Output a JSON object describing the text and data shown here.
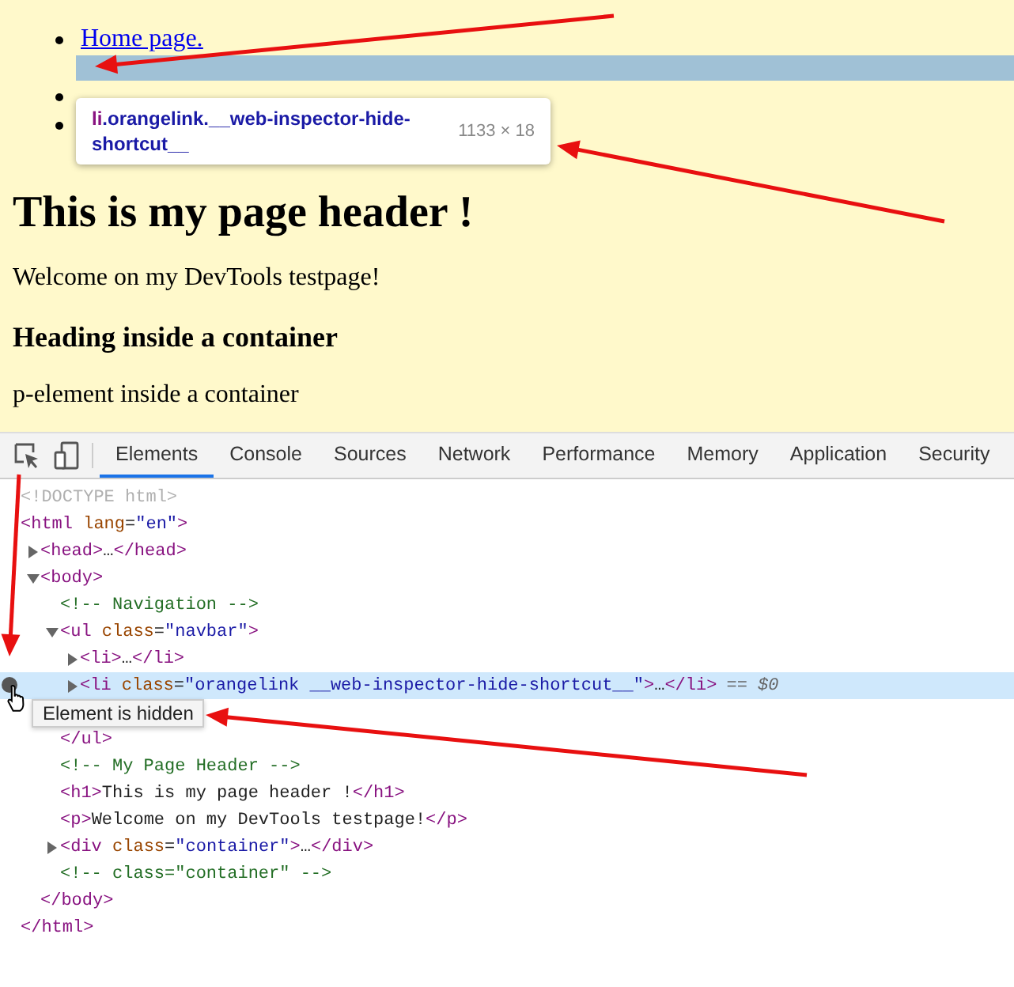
{
  "page": {
    "nav_items": [
      {
        "kind": "link",
        "label": "Home page."
      },
      {
        "kind": "highlight"
      },
      {
        "kind": "covered"
      },
      {
        "kind": "covered"
      }
    ],
    "inspect_tooltip": {
      "tag": "li",
      "classes": ".orangelink.__web-inspector-hide-shortcut__",
      "size": "1133 × 18"
    },
    "header": "This is my page header !",
    "welcome": "Welcome on my DevTools testpage!",
    "container_heading": "Heading inside a container",
    "container_text": "p-element inside a container"
  },
  "devtools": {
    "tabs": [
      {
        "label": "Elements",
        "selected": true
      },
      {
        "label": "Console",
        "selected": false
      },
      {
        "label": "Sources",
        "selected": false
      },
      {
        "label": "Network",
        "selected": false
      },
      {
        "label": "Performance",
        "selected": false
      },
      {
        "label": "Memory",
        "selected": false
      },
      {
        "label": "Application",
        "selected": false
      },
      {
        "label": "Security",
        "selected": false
      }
    ],
    "dom_tree": [
      {
        "tokens": [
          {
            "kind": "doctype",
            "t": "<!DOCTYPE html>"
          }
        ],
        "selected": false
      },
      {
        "tokens": [
          {
            "kind": "tag",
            "t": "<html "
          },
          {
            "kind": "attr",
            "t": "lang"
          },
          {
            "kind": "text",
            "t": "="
          },
          {
            "kind": "value",
            "t": "\"en\""
          },
          {
            "kind": "tag",
            "t": ">"
          }
        ],
        "selected": false,
        "close": [
          {
            "kind": "tag",
            "t": "</html>"
          }
        ],
        "children": [
          {
            "tokens": [
              {
                "kind": "tag",
                "t": "<head>"
              },
              {
                "kind": "text",
                "t": "…"
              },
              {
                "kind": "tag",
                "t": "</head>"
              }
            ],
            "expanded": false,
            "selected": false
          },
          {
            "tokens": [
              {
                "kind": "tag",
                "t": "<body>"
              }
            ],
            "expanded": true,
            "selected": false,
            "close": [
              {
                "kind": "tag",
                "t": "</body>"
              }
            ],
            "children": [
              {
                "tokens": [
                  {
                    "kind": "comment",
                    "t": "<!-- Navigation -->"
                  }
                ],
                "selected": false
              },
              {
                "tokens": [
                  {
                    "kind": "tag",
                    "t": "<ul "
                  },
                  {
                    "kind": "attr",
                    "t": "class"
                  },
                  {
                    "kind": "text",
                    "t": "="
                  },
                  {
                    "kind": "value",
                    "t": "\"navbar\""
                  },
                  {
                    "kind": "tag",
                    "t": ">"
                  }
                ],
                "expanded": true,
                "selected": false,
                "close": [
                  {
                    "kind": "tag",
                    "t": "</ul>"
                  }
                ],
                "children": [
                  {
                    "tokens": [
                      {
                        "kind": "tag",
                        "t": "<li>"
                      },
                      {
                        "kind": "text",
                        "t": "…"
                      },
                      {
                        "kind": "tag",
                        "t": "</li>"
                      }
                    ],
                    "expanded": false,
                    "selected": false,
                    "hidden": false
                  },
                  {
                    "tokens": [
                      {
                        "kind": "tag",
                        "t": "<li "
                      },
                      {
                        "kind": "attr",
                        "t": "class"
                      },
                      {
                        "kind": "text",
                        "t": "="
                      },
                      {
                        "kind": "value",
                        "t": "\"orangelink __web-inspector-hide-shortcut__\""
                      },
                      {
                        "kind": "tag",
                        "t": ">"
                      },
                      {
                        "kind": "text",
                        "t": "…"
                      },
                      {
                        "kind": "tag",
                        "t": "</li>"
                      }
                    ],
                    "expanded": false,
                    "selected": true,
                    "hidden": true,
                    "suffix": "== $0",
                    "tooltip": "Element is hidden"
                  }
                ]
              },
              {
                "tokens": [
                  {
                    "kind": "comment",
                    "t": "<!-- My Page Header -->"
                  }
                ],
                "selected": false
              },
              {
                "tokens": [
                  {
                    "kind": "tag",
                    "t": "<h1>"
                  },
                  {
                    "kind": "text",
                    "t": "This is my page header !"
                  },
                  {
                    "kind": "tag",
                    "t": "</h1>"
                  }
                ],
                "selected": false
              },
              {
                "tokens": [
                  {
                    "kind": "tag",
                    "t": "<p>"
                  },
                  {
                    "kind": "text",
                    "t": "Welcome on my DevTools testpage!"
                  },
                  {
                    "kind": "tag",
                    "t": "</p>"
                  }
                ],
                "selected": false
              },
              {
                "tokens": [
                  {
                    "kind": "tag",
                    "t": "<div "
                  },
                  {
                    "kind": "attr",
                    "t": "class"
                  },
                  {
                    "kind": "text",
                    "t": "="
                  },
                  {
                    "kind": "value",
                    "t": "\"container\""
                  },
                  {
                    "kind": "tag",
                    "t": ">"
                  },
                  {
                    "kind": "text",
                    "t": "…"
                  },
                  {
                    "kind": "tag",
                    "t": "</div>"
                  }
                ],
                "expanded": false,
                "selected": false
              },
              {
                "tokens": [
                  {
                    "kind": "comment",
                    "t": "<!-- class=\"container\" -->"
                  }
                ],
                "selected": false
              }
            ]
          }
        ]
      }
    ]
  }
}
